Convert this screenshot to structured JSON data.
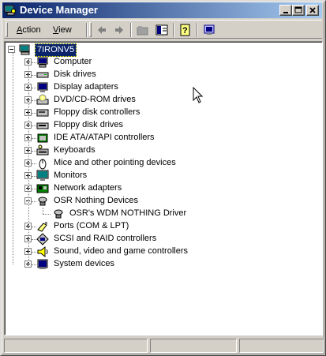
{
  "window": {
    "title": "Device Manager"
  },
  "toolbar": {
    "action_label": "Action",
    "action_key": "A",
    "view_label": "View",
    "view_key": "V"
  },
  "tree": {
    "root": "7IRONV5",
    "categories": [
      {
        "label": "Computer",
        "icon": "computer-icon",
        "expanded": false
      },
      {
        "label": "Disk drives",
        "icon": "disk-drive-icon",
        "expanded": false
      },
      {
        "label": "Display adapters",
        "icon": "display-adapter-icon",
        "expanded": false
      },
      {
        "label": "DVD/CD-ROM drives",
        "icon": "cdrom-icon",
        "expanded": false
      },
      {
        "label": "Floppy disk controllers",
        "icon": "floppy-controller-icon",
        "expanded": false
      },
      {
        "label": "Floppy disk drives",
        "icon": "floppy-drive-icon",
        "expanded": false
      },
      {
        "label": "IDE ATA/ATAPI controllers",
        "icon": "ide-controller-icon",
        "expanded": false
      },
      {
        "label": "Keyboards",
        "icon": "keyboard-icon",
        "expanded": false
      },
      {
        "label": "Mice and other pointing devices",
        "icon": "mouse-icon",
        "expanded": false
      },
      {
        "label": "Monitors",
        "icon": "monitor-icon",
        "expanded": false
      },
      {
        "label": "Network adapters",
        "icon": "network-adapter-icon",
        "expanded": false
      },
      {
        "label": "OSR Nothing Devices",
        "icon": "osr-device-icon",
        "expanded": true,
        "children": [
          {
            "label": "OSR's WDM NOTHING Driver",
            "icon": "osr-device-icon"
          }
        ]
      },
      {
        "label": "Ports (COM & LPT)",
        "icon": "port-icon",
        "expanded": false
      },
      {
        "label": "SCSI and RAID controllers",
        "icon": "scsi-icon",
        "expanded": false
      },
      {
        "label": "Sound, video and game controllers",
        "icon": "sound-icon",
        "expanded": false
      },
      {
        "label": "System devices",
        "icon": "system-device-icon",
        "expanded": false
      }
    ]
  },
  "colors": {
    "titlebar_start": "#0a246a",
    "titlebar_end": "#a6caf0",
    "selection": "#0a246a",
    "chrome": "#d4d0c8"
  }
}
